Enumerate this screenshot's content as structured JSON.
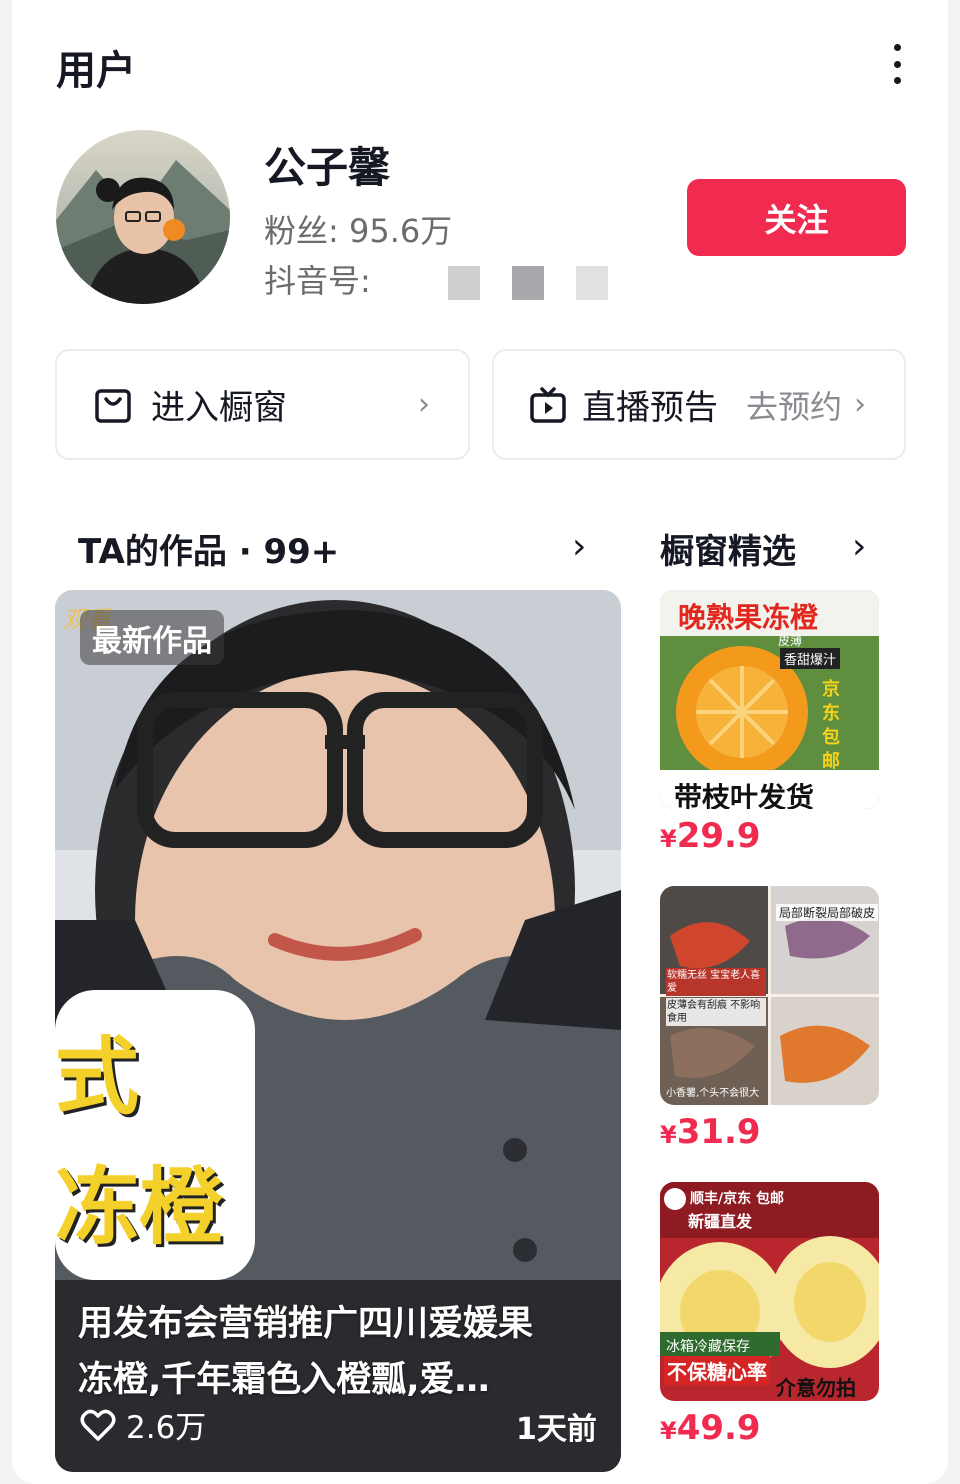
{
  "header": {
    "title": "用户"
  },
  "profile": {
    "name": "公子馨",
    "fans_label": "粉丝:",
    "fans_value": "95.6万",
    "douyin_id_label": "抖音号:",
    "follow_label": "关注"
  },
  "entries": {
    "shop_label": "进入橱窗",
    "live_label": "直播预告",
    "live_action": "去预约"
  },
  "works": {
    "title": "TA的作品 · 99+",
    "badge": "最新作品",
    "overlay_text_1": "式",
    "overlay_text_2": "冻橙",
    "corner_text": "观看",
    "caption_line_1": "用发布会营销推广四川爱媛果",
    "caption_line_2": "冻橙,千年霜色入橙瓢,爱…",
    "likes": "2.6万",
    "time_ago": "1天前"
  },
  "shop_picks": {
    "title": "橱窗精选",
    "products": [
      {
        "price_symbol": "¥",
        "price": "29.9",
        "title_text": "晚熟果冻橙",
        "sub_text": "皮薄",
        "tag_text": "香甜爆汁",
        "side_text": "京东包邮",
        "bottom_text": "带枝叶发货"
      },
      {
        "price_symbol": "¥",
        "price": "31.9",
        "label_1": "局部断裂局部破皮",
        "label_2": "软糯无丝 宝宝老人喜爱",
        "label_3": "皮薄会有刮痕 不影响食用",
        "label_4": "小香薯,个头不会很大"
      },
      {
        "price_symbol": "¥",
        "price": "49.9",
        "top_text": "顺丰/京东 包邮",
        "sub_text": "新疆直发",
        "tag_text": "冰箱冷藏保存",
        "warn_text": "不保糖心率",
        "note_text": "介意勿拍"
      }
    ]
  },
  "colors": {
    "accent": "#f02b4f",
    "text": "#161823",
    "muted": "#8a8b91"
  }
}
